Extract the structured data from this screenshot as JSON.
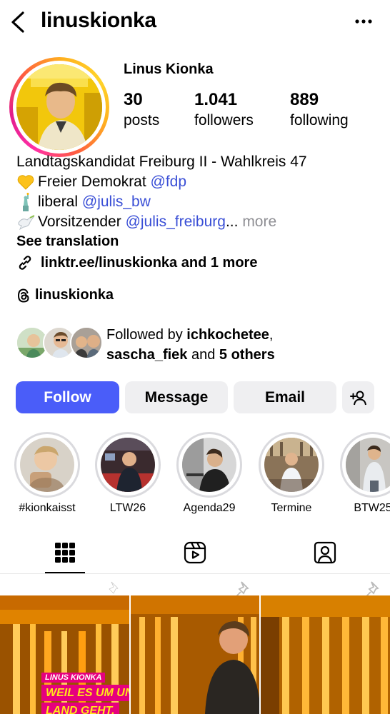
{
  "header": {
    "username": "linuskionka"
  },
  "profile": {
    "display_name": "Linus Kionka",
    "stats": [
      {
        "value": "30",
        "label": "posts"
      },
      {
        "value": "1.041",
        "label": "followers"
      },
      {
        "value": "889",
        "label": "following"
      }
    ]
  },
  "bio": {
    "line1": "Landtagskandidat Freiburg II - Wahlkreis 47",
    "line2_text": "Freier Demokrat ",
    "line2_mention": "@fdp",
    "line3_text": "liberal ",
    "line3_mention": "@julis_bw",
    "line4_text": "Vorsitzender ",
    "line4_mention": "@julis_freiburg",
    "line4_ellipsis": "...",
    "more": " more",
    "see_translation": "See translation",
    "link": "linktr.ee/linuskionka and 1 more",
    "threads": "linuskionka"
  },
  "followed_by": {
    "prefix": "Followed by ",
    "user1": "ichkochetee",
    "sep": ",",
    "user2": "sascha_fiek",
    "and": " and ",
    "others": "5 others"
  },
  "actions": {
    "follow": "Follow",
    "message": "Message",
    "email": "Email"
  },
  "highlights": [
    {
      "label": "#kionkaisst"
    },
    {
      "label": "LTW26"
    },
    {
      "label": "Agenda29"
    },
    {
      "label": "Termine"
    },
    {
      "label": "BTW25"
    }
  ],
  "post_overlay": {
    "small": "LINUS KIONKA",
    "big_line1": "WEIL ES UM UNSER",
    "big_line2": "LAND GEHT."
  },
  "colors": {
    "follow_button": "#4a5df9",
    "mention": "#3a4fd6",
    "secondary_button": "#efeff1"
  },
  "icons": [
    "back-arrow-icon",
    "more-dots-icon",
    "link-icon",
    "threads-icon",
    "add-user-icon",
    "grid-icon",
    "reels-icon",
    "tagged-icon",
    "pin-icon"
  ]
}
